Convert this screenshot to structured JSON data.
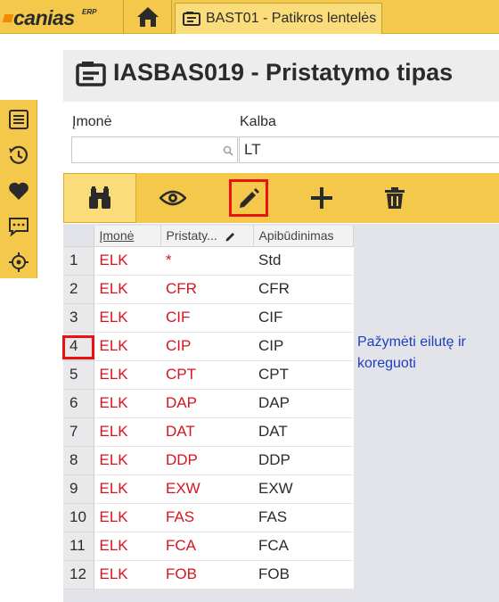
{
  "app": {
    "logo_text": "canias",
    "logo_sup": "ERP"
  },
  "tab": {
    "label": "BAST01 - Patikros lentelės"
  },
  "page": {
    "title": "IASBAS019 - Pristatymo tipas"
  },
  "fields": {
    "company_label": "Įmonė",
    "company_value": "",
    "language_label": "Kalba",
    "language_value": "LT"
  },
  "grid": {
    "headers": [
      "Įmonė",
      "Pristaty...",
      "Apibūdinimas"
    ],
    "rows": [
      {
        "n": "1",
        "company": "ELK",
        "type": "*",
        "desc": "Std"
      },
      {
        "n": "2",
        "company": "ELK",
        "type": "CFR",
        "desc": "CFR"
      },
      {
        "n": "3",
        "company": "ELK",
        "type": "CIF",
        "desc": "CIF"
      },
      {
        "n": "4",
        "company": "ELK",
        "type": "CIP",
        "desc": "CIP"
      },
      {
        "n": "5",
        "company": "ELK",
        "type": "CPT",
        "desc": "CPT"
      },
      {
        "n": "6",
        "company": "ELK",
        "type": "DAP",
        "desc": "DAP"
      },
      {
        "n": "7",
        "company": "ELK",
        "type": "DAT",
        "desc": "DAT"
      },
      {
        "n": "8",
        "company": "ELK",
        "type": "DDP",
        "desc": "DDP"
      },
      {
        "n": "9",
        "company": "ELK",
        "type": "EXW",
        "desc": "EXW"
      },
      {
        "n": "10",
        "company": "ELK",
        "type": "FAS",
        "desc": "FAS"
      },
      {
        "n": "11",
        "company": "ELK",
        "type": "FCA",
        "desc": "FCA"
      },
      {
        "n": "12",
        "company": "ELK",
        "type": "FOB",
        "desc": "FOB"
      }
    ]
  },
  "annotation": {
    "text": "Pažymėti eilutę ir koreguoti"
  },
  "colors": {
    "accent": "#f4c84b",
    "key_text": "#d7141e",
    "annotation": "#1c3fbf",
    "highlight": "#e8120f"
  }
}
